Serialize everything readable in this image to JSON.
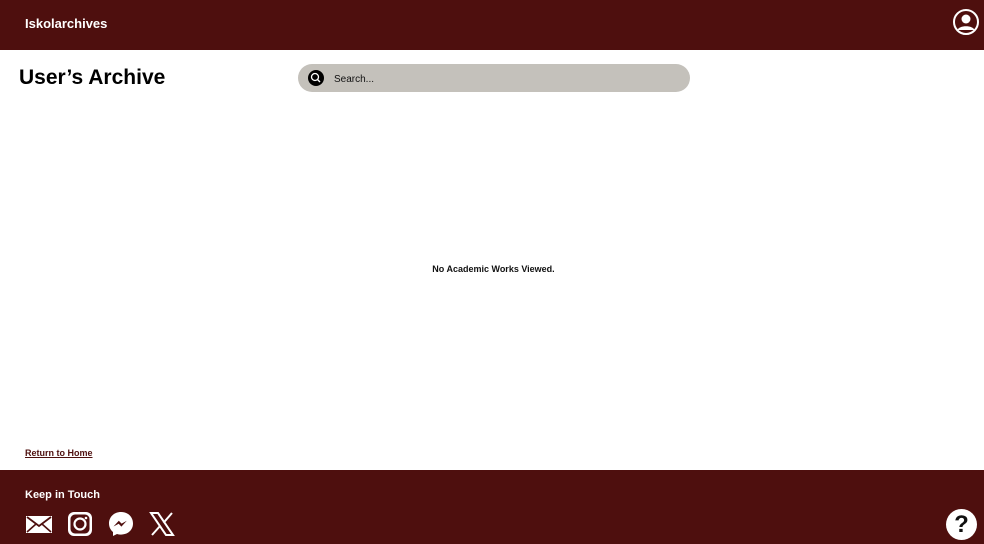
{
  "header": {
    "brand": "Iskolarchives",
    "profile_icon": "user-circle-icon"
  },
  "main": {
    "title": "User’s Archive",
    "search": {
      "placeholder": "Search...",
      "value": "",
      "icon": "search-icon"
    },
    "empty_message": "No Academic Works Viewed.",
    "return_link": "Return to Home"
  },
  "footer": {
    "title": "Keep in Touch",
    "social_icons": [
      "mail-icon",
      "instagram-icon",
      "messenger-icon",
      "x-icon"
    ],
    "help_icon": "question-icon",
    "help_glyph": "?"
  },
  "colors": {
    "brand": "#4e0f0e",
    "search_bg": "#c4c1bb",
    "background": "#ffffff"
  }
}
